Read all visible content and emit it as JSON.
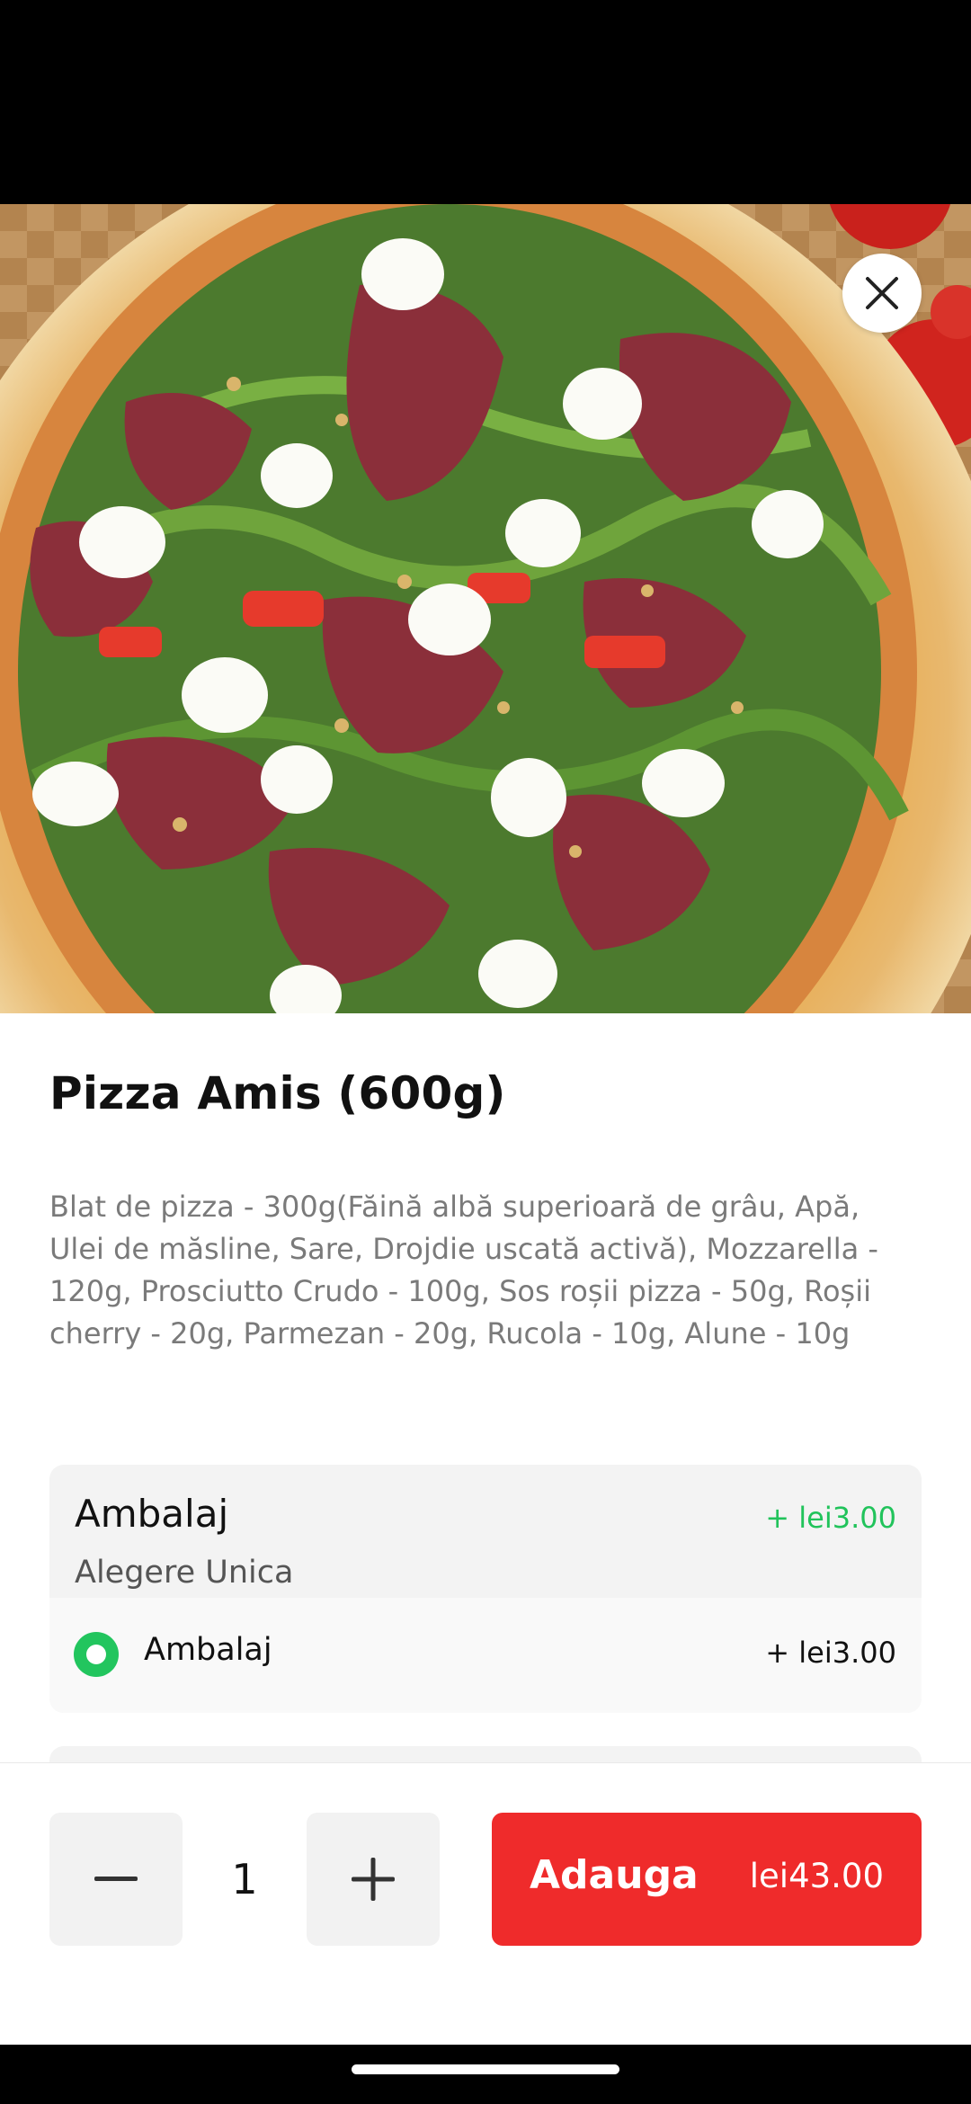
{
  "product": {
    "title": "Pizza Amis (600g)",
    "description": "Blat de pizza - 300g(Făină albă superioară de grâu,  Apă, Ulei de măsline, Sare, Drojdie uscată activă), Mozzarella - 120g, Prosciutto Crudo - 100g, Sos roșii pizza - 50g, Roșii cherry - 20g, Parmezan - 20g, Rucola - 10g, Alune - 10g"
  },
  "option_group": {
    "title": "Ambalaj",
    "price": "+ lei3.00",
    "subtitle": "Alegere Unica",
    "options": [
      {
        "label": "Ambalaj",
        "price": "+ lei3.00",
        "selected": true
      }
    ]
  },
  "footer": {
    "quantity": "1",
    "add_label": "Adauga",
    "add_price": "lei43.00"
  },
  "icons": {
    "close": "close-icon",
    "minus": "minus-icon",
    "plus": "plus-icon"
  },
  "colors": {
    "accent_red": "#ef2b2b",
    "accent_green": "#21c35b"
  }
}
